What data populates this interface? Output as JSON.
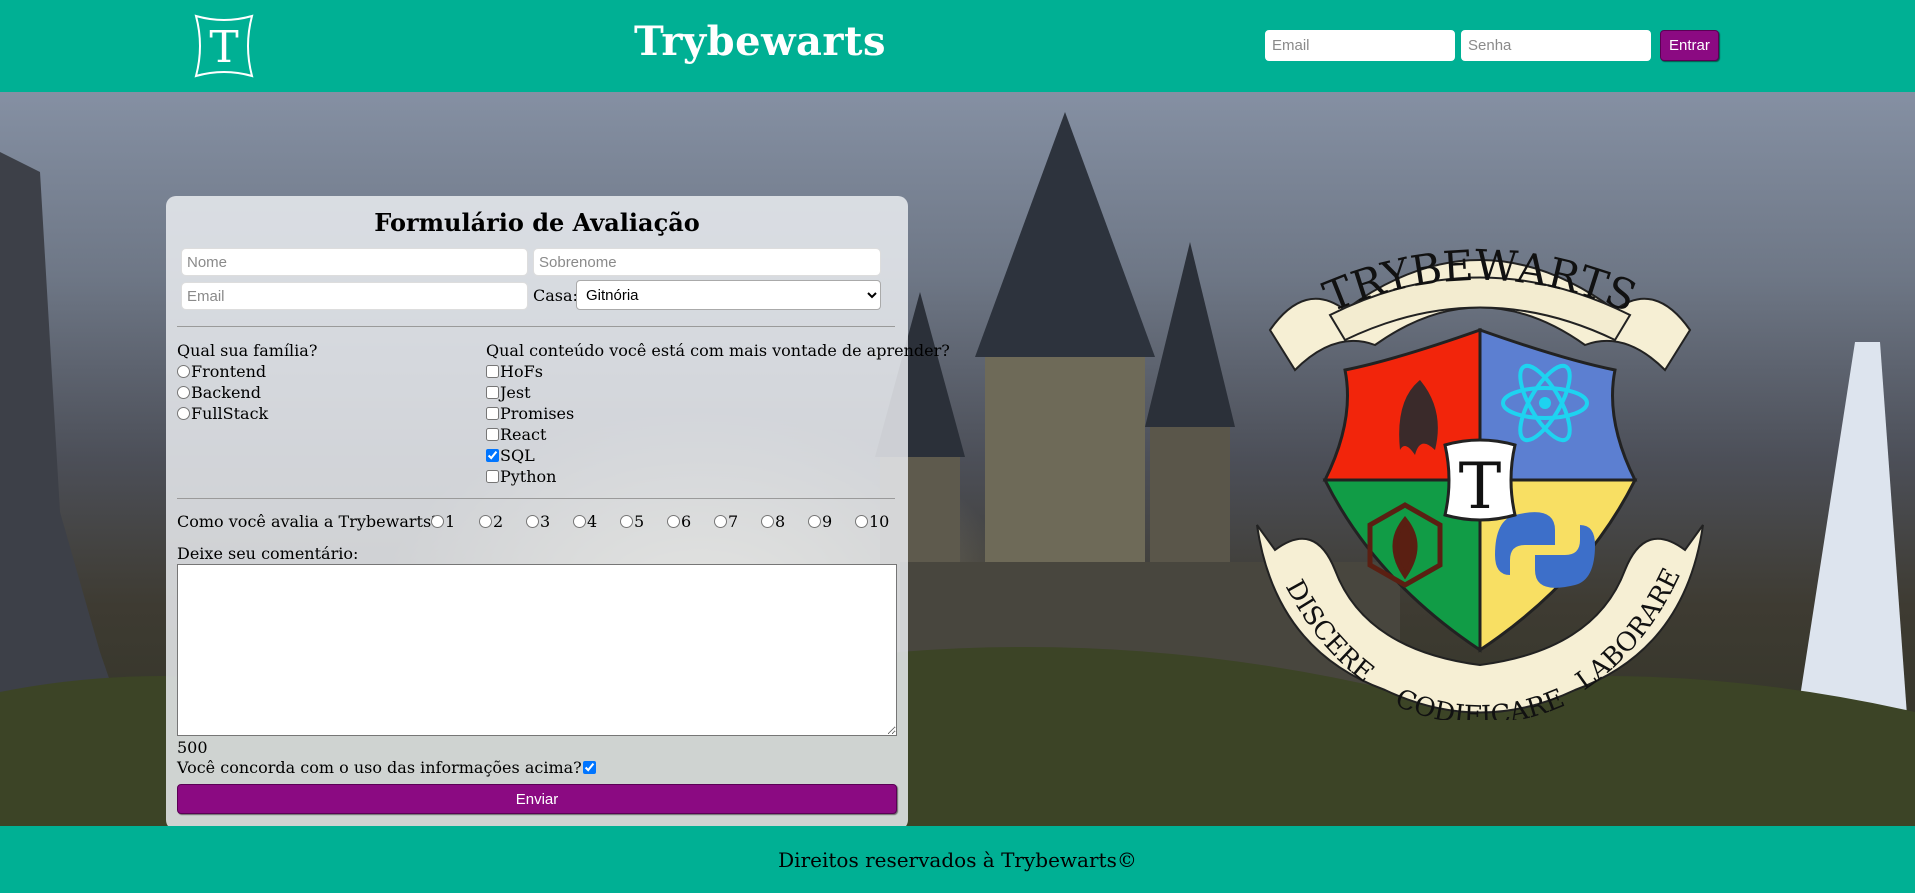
{
  "header": {
    "logo_letter": "T",
    "site_title": "Trybewarts",
    "login": {
      "email_placeholder": "Email",
      "password_placeholder": "Senha",
      "submit_label": "Entrar"
    }
  },
  "form": {
    "title": "Formulário de Avaliação",
    "name_placeholder": "Nome",
    "lastname_placeholder": "Sobrenome",
    "email_placeholder": "Email",
    "house_label": "Casa:",
    "house_selected": "Gitnória",
    "family": {
      "question": "Qual sua família?",
      "options": [
        "Frontend",
        "Backend",
        "FullStack"
      ]
    },
    "content": {
      "question": "Qual conteúdo você está com mais vontade de aprender?",
      "options": [
        "HoFs",
        "Jest",
        "Promises",
        "React",
        "SQL",
        "Python"
      ],
      "checked": [
        "SQL"
      ]
    },
    "rating": {
      "question": "Como você avalia a Trybewarts?",
      "options": [
        "1",
        "2",
        "3",
        "4",
        "5",
        "6",
        "7",
        "8",
        "9",
        "10"
      ]
    },
    "comment_label": "Deixe seu comentário:",
    "counter": "500",
    "agreement_label": "Você concorda com o uso das informações acima?",
    "agreement_checked": true,
    "submit_label": "Enviar"
  },
  "crest": {
    "top_banner": "TRYBEWARTS",
    "center_letter": "T",
    "left_banner": "DISCERE",
    "bottom_banner": "CODIFICARE",
    "right_banner": "LABORARE"
  },
  "footer": {
    "text": "Direitos reservados à Trybewarts©"
  },
  "colors": {
    "brand_teal": "#00b094",
    "button_purple": "#8b0a82",
    "crest_red": "#f2250b",
    "crest_blue": "#5c7fd1",
    "crest_green": "#119c46",
    "crest_yellow": "#f8df63"
  }
}
